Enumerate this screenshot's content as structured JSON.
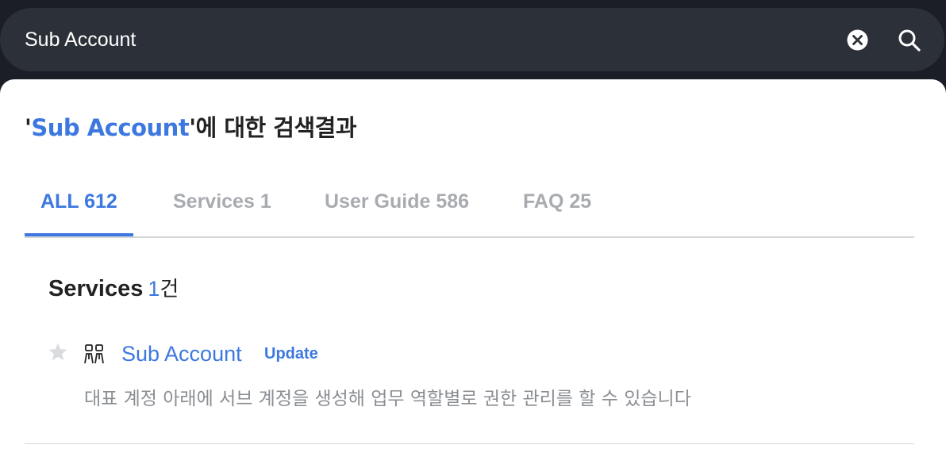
{
  "search": {
    "value": "Sub Account"
  },
  "results_header": {
    "open_quote": "'",
    "query": "Sub Account",
    "suffix": "'에 대한 검색결과"
  },
  "tabs": [
    {
      "label": "ALL 612",
      "active": true
    },
    {
      "label": "Services 1",
      "active": false
    },
    {
      "label": "User Guide 586",
      "active": false
    },
    {
      "label": "FAQ 25",
      "active": false
    }
  ],
  "services_section": {
    "title": "Services",
    "count": "1",
    "unit": "건",
    "items": [
      {
        "name": "Sub Account",
        "badge": "Update",
        "description": "대표 계정 아래에 서브 계정을 생성해 업무 역할별로 권한 관리를 할 수 있습니다",
        "icon": "users-icon",
        "favorite": false
      }
    ]
  },
  "colors": {
    "accent": "#3d78e0",
    "topbar_bg": "#1b1e26",
    "search_bg": "#2c3038",
    "muted_text": "#8a8d92",
    "tab_inactive": "#a8abb0"
  }
}
